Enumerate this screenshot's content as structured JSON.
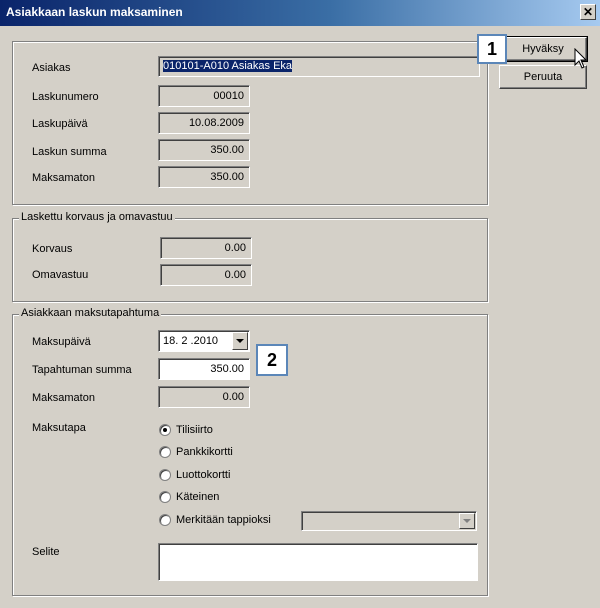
{
  "window": {
    "title": "Asiakkaan laskun maksaminen",
    "close_symbol": "✕"
  },
  "buttons": {
    "ok": "Hyväksy",
    "cancel": "Peruuta"
  },
  "invoice": {
    "customer_label": "Asiakas",
    "customer_value": "010101-A010 Asiakas Eka",
    "number_label": "Laskunumero",
    "number_value": "00010",
    "date_label": "Laskupäivä",
    "date_value": "10.08.2009",
    "sum_label": "Laskun summa",
    "sum_value": "350.00",
    "unpaid_label": "Maksamaton",
    "unpaid_value": "350.00"
  },
  "compensation": {
    "title": "Laskettu korvaus ja omavastuu",
    "korvaus_label": "Korvaus",
    "korvaus_value": "0.00",
    "omavastuu_label": "Omavastuu",
    "omavastuu_value": "0.00"
  },
  "payment": {
    "title": "Asiakkaan maksutapahtuma",
    "date_label": "Maksupäivä",
    "date_value": "18. 2 .2010",
    "amount_label": "Tapahtuman summa",
    "amount_value": "350.00",
    "unpaid_label": "Maksamaton",
    "unpaid_value": "0.00",
    "method_label": "Maksutapa",
    "methods": [
      {
        "label": "Tilisiirto",
        "selected": true
      },
      {
        "label": "Pankkikortti",
        "selected": false
      },
      {
        "label": "Luottokortti",
        "selected": false
      },
      {
        "label": "Käteinen",
        "selected": false
      },
      {
        "label": "Merkitään tappioksi",
        "selected": false
      }
    ],
    "note_label": "Selite",
    "note_value": ""
  },
  "callouts": {
    "first": "1",
    "second": "2"
  },
  "icons": {
    "close": "close-icon",
    "dropdown": "chevron-down-icon",
    "cursor": "mouse-pointer-icon"
  }
}
